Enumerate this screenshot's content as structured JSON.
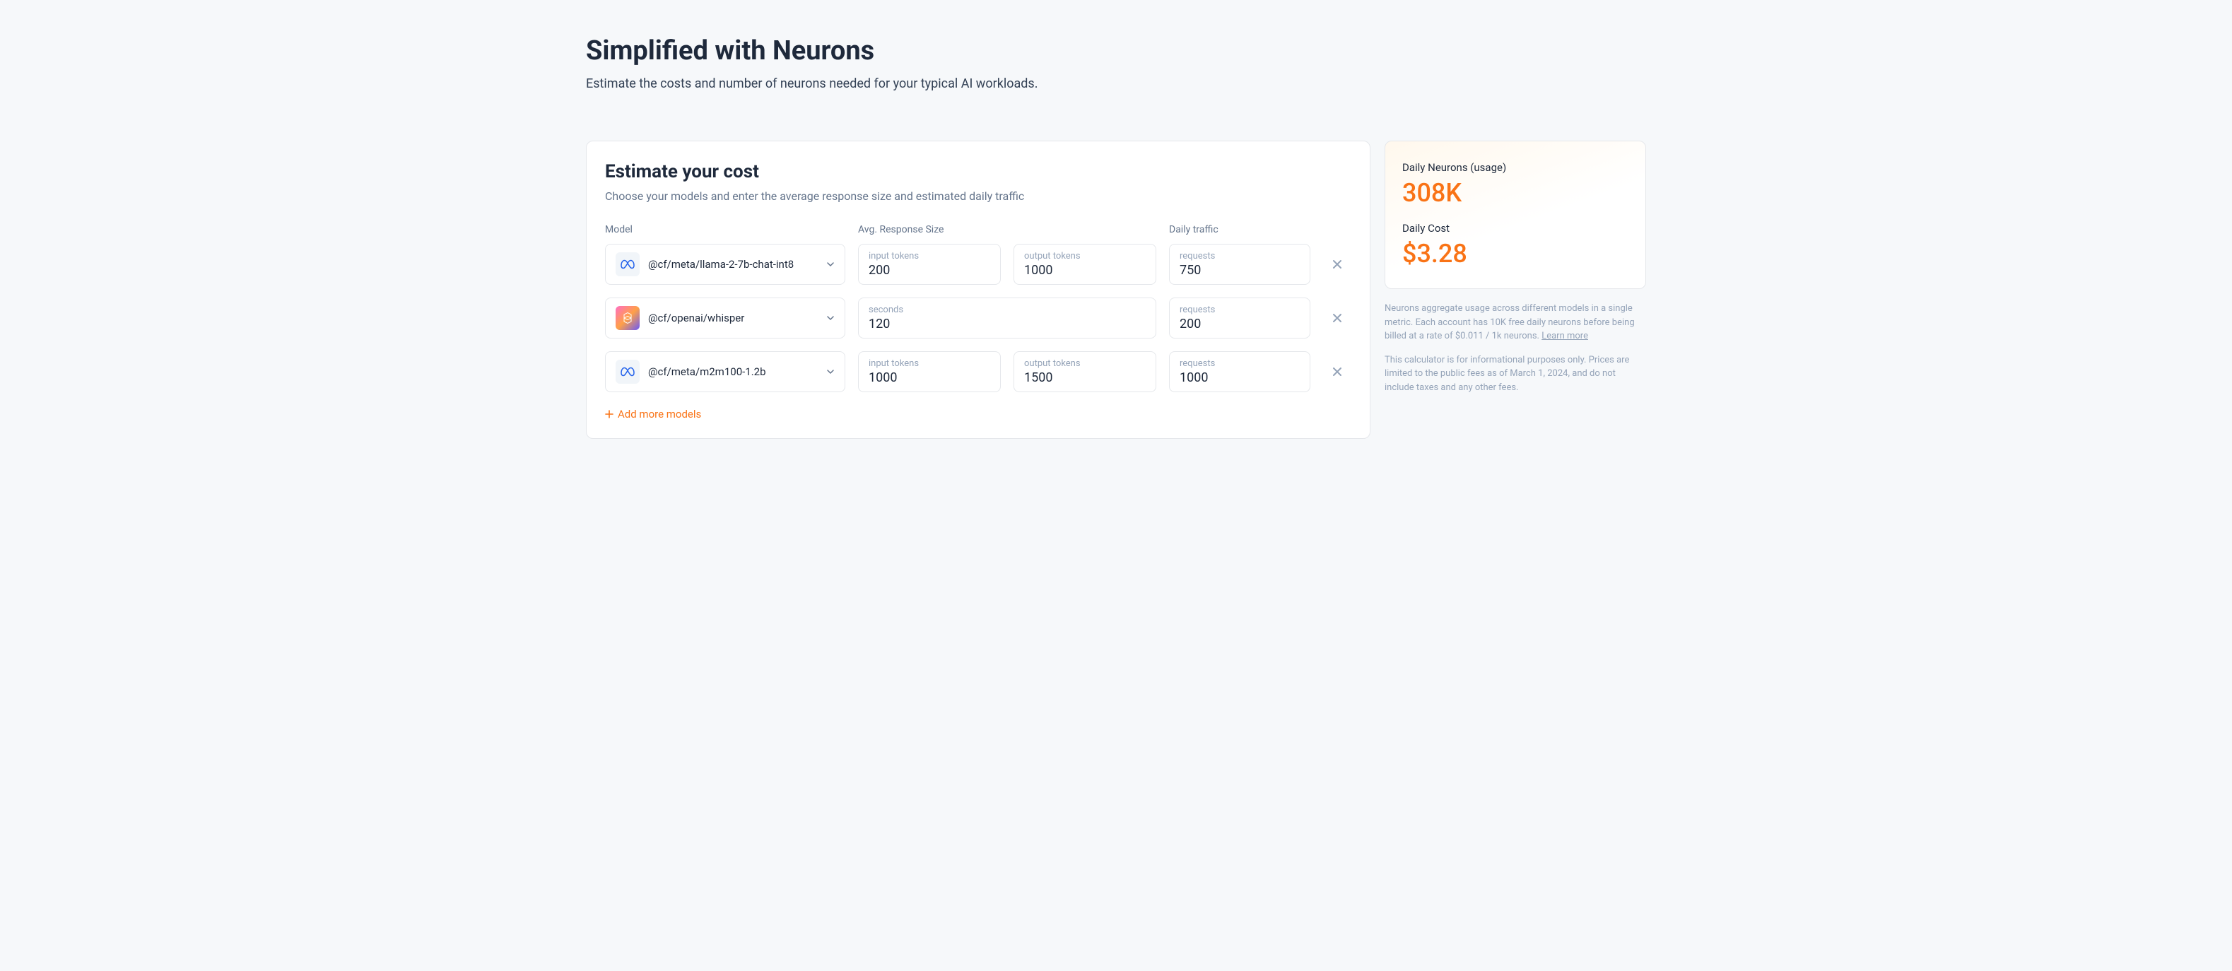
{
  "header": {
    "title": "Simplified with Neurons",
    "subtitle": "Estimate the costs and number of neurons needed for your typical AI workloads."
  },
  "card": {
    "title": "Estimate your cost",
    "subtitle": "Choose your models and enter the average response size and estimated daily traffic",
    "columns": {
      "model": "Model",
      "response": "Avg. Response Size",
      "traffic": "Daily traffic"
    },
    "labels": {
      "input_tokens": "input tokens",
      "output_tokens": "output tokens",
      "seconds": "seconds",
      "requests": "requests"
    },
    "add_label": "Add more models"
  },
  "rows": [
    {
      "icon": "meta",
      "model": "@cf/meta/llama-2-7b-chat-int8",
      "type": "tokens",
      "input": "200",
      "output": "1000",
      "requests": "750"
    },
    {
      "icon": "openai",
      "model": "@cf/openai/whisper",
      "type": "seconds",
      "seconds": "120",
      "requests": "200"
    },
    {
      "icon": "meta",
      "model": "@cf/meta/m2m100-1.2b",
      "type": "tokens",
      "input": "1000",
      "output": "1500",
      "requests": "1000"
    }
  ],
  "summary": {
    "neurons_label": "Daily Neurons (usage)",
    "neurons_value": "308K",
    "cost_label": "Daily Cost",
    "cost_value": "$3.28"
  },
  "footnotes": {
    "note1": "Neurons aggregate usage across different models in a single metric. Each account has 10K free daily neurons before being billed at a rate of $0.011 / 1k neurons. ",
    "learn_more": "Learn more",
    "note2": "This calculator is for informational purposes only. Prices are limited to the public fees as of March 1, 2024, and do not include taxes and any other fees."
  }
}
